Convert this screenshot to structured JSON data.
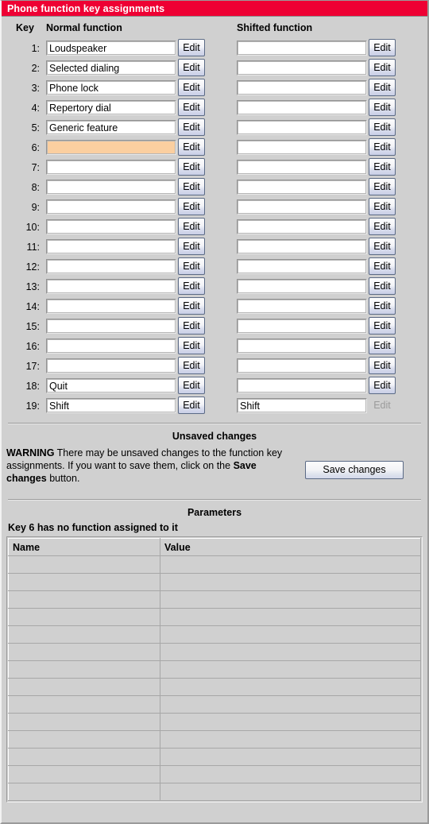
{
  "window": {
    "title": "Phone function key assignments"
  },
  "table_headers": {
    "key": "Key",
    "normal": "Normal function",
    "shifted": "Shifted function"
  },
  "edit_label": "Edit",
  "rows": [
    {
      "key": "1:",
      "normal": "Loudspeaker",
      "shifted": "",
      "highlight": false,
      "shifted_edit_disabled": false
    },
    {
      "key": "2:",
      "normal": "Selected dialing",
      "shifted": "",
      "highlight": false,
      "shifted_edit_disabled": false
    },
    {
      "key": "3:",
      "normal": "Phone lock",
      "shifted": "",
      "highlight": false,
      "shifted_edit_disabled": false
    },
    {
      "key": "4:",
      "normal": "Repertory dial",
      "shifted": "",
      "highlight": false,
      "shifted_edit_disabled": false
    },
    {
      "key": "5:",
      "normal": "Generic feature",
      "shifted": "",
      "highlight": false,
      "shifted_edit_disabled": false
    },
    {
      "key": "6:",
      "normal": "",
      "shifted": "",
      "highlight": true,
      "shifted_edit_disabled": false
    },
    {
      "key": "7:",
      "normal": "",
      "shifted": "",
      "highlight": false,
      "shifted_edit_disabled": false
    },
    {
      "key": "8:",
      "normal": "",
      "shifted": "",
      "highlight": false,
      "shifted_edit_disabled": false
    },
    {
      "key": "9:",
      "normal": "",
      "shifted": "",
      "highlight": false,
      "shifted_edit_disabled": false
    },
    {
      "key": "10:",
      "normal": "",
      "shifted": "",
      "highlight": false,
      "shifted_edit_disabled": false
    },
    {
      "key": "11:",
      "normal": "",
      "shifted": "",
      "highlight": false,
      "shifted_edit_disabled": false
    },
    {
      "key": "12:",
      "normal": "",
      "shifted": "",
      "highlight": false,
      "shifted_edit_disabled": false
    },
    {
      "key": "13:",
      "normal": "",
      "shifted": "",
      "highlight": false,
      "shifted_edit_disabled": false
    },
    {
      "key": "14:",
      "normal": "",
      "shifted": "",
      "highlight": false,
      "shifted_edit_disabled": false
    },
    {
      "key": "15:",
      "normal": "",
      "shifted": "",
      "highlight": false,
      "shifted_edit_disabled": false
    },
    {
      "key": "16:",
      "normal": "",
      "shifted": "",
      "highlight": false,
      "shifted_edit_disabled": false
    },
    {
      "key": "17:",
      "normal": "",
      "shifted": "",
      "highlight": false,
      "shifted_edit_disabled": false
    },
    {
      "key": "18:",
      "normal": "Quit",
      "shifted": "",
      "highlight": false,
      "shifted_edit_disabled": false
    },
    {
      "key": "19:",
      "normal": "Shift",
      "shifted": "Shift",
      "highlight": false,
      "shifted_edit_disabled": true
    }
  ],
  "unsaved": {
    "title": "Unsaved changes",
    "warning_label": "WARNING",
    "warning_body_1": " There may be unsaved changes to the function key assignments. If you want to save them, click on the ",
    "warning_emphasis": "Save changes",
    "warning_body_2": " button.",
    "save_label": "Save changes"
  },
  "parameters": {
    "title": "Parameters",
    "note": "Key 6 has no function assigned to it",
    "columns": [
      "Name",
      "Value"
    ],
    "rows": [
      {
        "name": "",
        "value": ""
      },
      {
        "name": "",
        "value": ""
      },
      {
        "name": "",
        "value": ""
      },
      {
        "name": "",
        "value": ""
      },
      {
        "name": "",
        "value": ""
      },
      {
        "name": "",
        "value": ""
      },
      {
        "name": "",
        "value": ""
      },
      {
        "name": "",
        "value": ""
      },
      {
        "name": "",
        "value": ""
      },
      {
        "name": "",
        "value": ""
      },
      {
        "name": "",
        "value": ""
      },
      {
        "name": "",
        "value": ""
      },
      {
        "name": "",
        "value": ""
      },
      {
        "name": "",
        "value": ""
      }
    ]
  },
  "colors": {
    "titlebar": "#ee0033",
    "panel": "#d0d0d0",
    "highlight_row": "#fbcfa0"
  }
}
